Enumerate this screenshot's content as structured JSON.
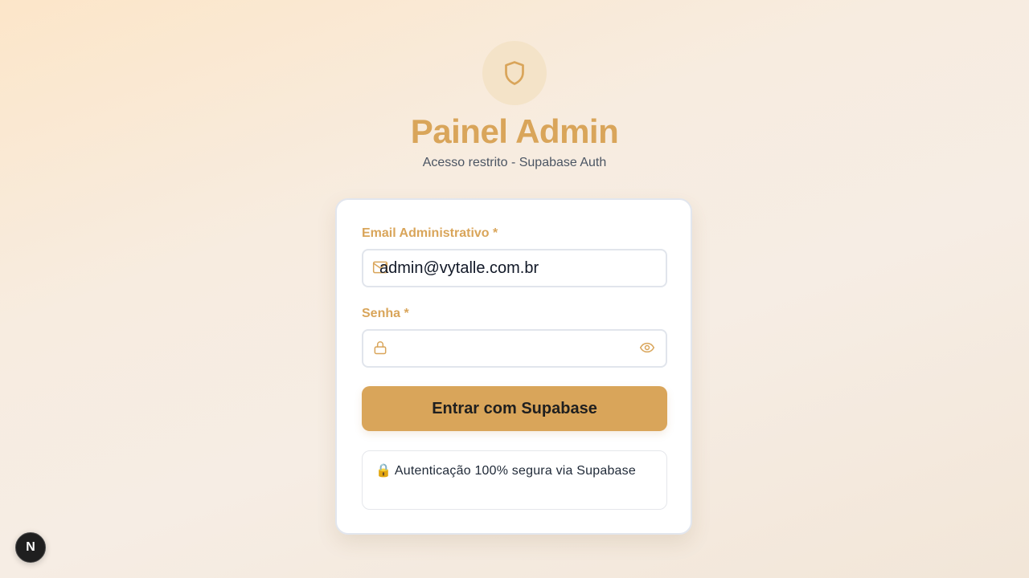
{
  "header": {
    "icon": "shield-icon",
    "title": "Painel Admin",
    "subtitle": "Acesso restrito - Supabase Auth"
  },
  "form": {
    "email": {
      "label": "Email Administrativo *",
      "value": "admin@vytalle.com.br",
      "icon": "mail-icon"
    },
    "password": {
      "label": "Senha *",
      "value": "",
      "icon": "lock-icon",
      "toggle_icon": "eye-icon"
    },
    "submit_label": "Entrar com Supabase",
    "security_note_emoji": "🔒",
    "security_note": "Autenticação 100% segura via Supabase"
  },
  "dev_badge": {
    "label": "N"
  },
  "colors": {
    "accent": "#d9a55a",
    "icon_bg": "#f4e3c8",
    "text": "#1f2937"
  }
}
